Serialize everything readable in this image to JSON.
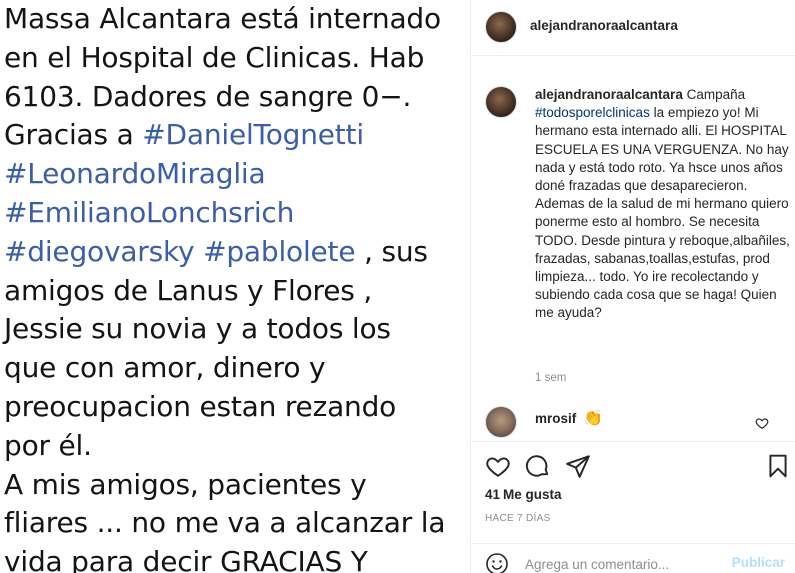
{
  "post_image": {
    "lines": [
      {
        "parts": [
          {
            "t": "Massa Alcantara está internado",
            "tag": false
          }
        ]
      },
      {
        "parts": [
          {
            "t": "en el Hospital de Clinicas. Hab",
            "tag": false
          }
        ]
      },
      {
        "parts": [
          {
            "t": "6103. Dadores de sangre 0−.",
            "tag": false
          }
        ]
      },
      {
        "parts": [
          {
            "t": "Gracias a ",
            "tag": false
          },
          {
            "t": "#DanielTognetti",
            "tag": true
          }
        ]
      },
      {
        "parts": [
          {
            "t": "#LeonardoMiraglia",
            "tag": true
          }
        ]
      },
      {
        "parts": [
          {
            "t": "#EmilianoLonchsrich",
            "tag": true
          }
        ]
      },
      {
        "parts": [
          {
            "t": "#diegovarsky",
            "tag": true
          },
          {
            "t": " ",
            "tag": false
          },
          {
            "t": "#pablolete",
            "tag": true
          },
          {
            "t": " , sus",
            "tag": false
          }
        ]
      },
      {
        "parts": [
          {
            "t": "amigos de Lanus y Flores ,",
            "tag": false
          }
        ]
      },
      {
        "parts": [
          {
            "t": "Jessie su novia y a todos los",
            "tag": false
          }
        ]
      },
      {
        "parts": [
          {
            "t": "que con amor, dinero y",
            "tag": false
          }
        ]
      },
      {
        "parts": [
          {
            "t": "preocupacion estan rezando",
            "tag": false
          }
        ]
      },
      {
        "parts": [
          {
            "t": "por él.",
            "tag": false
          }
        ]
      },
      {
        "parts": [
          {
            "t": "A mis amigos, pacientes y",
            "tag": false
          }
        ]
      },
      {
        "parts": [
          {
            "t": "fliares ... no me va a alcanzar la",
            "tag": false
          }
        ]
      },
      {
        "parts": [
          {
            "t": "vida para decir GRACIAS Y",
            "tag": false
          }
        ]
      }
    ]
  },
  "header": {
    "username": "alejandranoraalcantara"
  },
  "caption": {
    "username": "alejandranoraalcantara",
    "text_before_tag": " Campaña ",
    "hashtag": "#todosporelclinicas",
    "text_after_tag": " la empiezo yo! Mi hermano esta internado alli. El HOSPITAL ESCUELA ES UNA VERGUENZA. No hay nada y está todo roto. Ya hsce unos años doné frazadas que desaparecieron. Ademas de la salud de mi hermano quiero ponerme esto al hombro. Se necesita TODO. Desde pintura y reboque,albañiles, frazadas, sabanas,toallas,estufas, prod limpieza... todo. Yo ire recolectando y subiendo cada cosa que se haga! Quien me ayuda?",
    "time": "1 sem"
  },
  "comment": {
    "username": "mrosif",
    "emoji": "👏",
    "like_icon": "heart-outline-icon"
  },
  "actions": {
    "icons": [
      "heart-icon",
      "comment-bubble-icon",
      "share-paper-plane-icon",
      "bookmark-icon"
    ]
  },
  "likes": {
    "count": "41",
    "label": "Me gusta"
  },
  "date": "HACE 7 DÍAS",
  "add_comment": {
    "placeholder": "Agrega un comentario...",
    "publish": "Publicar"
  },
  "colors": {
    "hashtag_image": "#3a5fa8",
    "hashtag_caption": "#00376b",
    "publish_disabled": "#b2dffc",
    "muted": "#8e8e8e"
  }
}
